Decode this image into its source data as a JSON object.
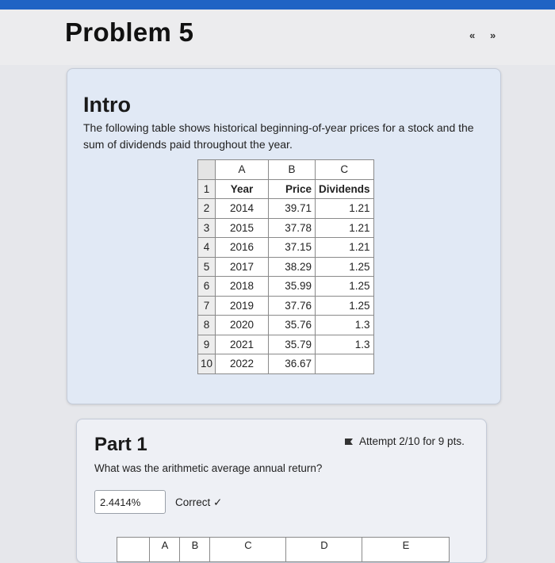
{
  "page": {
    "title": "Problem 5",
    "nav_prev": "«",
    "nav_next": "»"
  },
  "intro": {
    "title": "Intro",
    "text": "The following table shows historical beginning-of-year prices for a stock and the sum of dividends paid throughout the year."
  },
  "sheet": {
    "col_letters": [
      "A",
      "B",
      "C"
    ],
    "header": {
      "num": "1",
      "a": "Year",
      "b": "Price",
      "c": "Dividends"
    },
    "rows": [
      {
        "num": "2",
        "year": "2014",
        "price": "39.71",
        "div": "1.21"
      },
      {
        "num": "3",
        "year": "2015",
        "price": "37.78",
        "div": "1.21"
      },
      {
        "num": "4",
        "year": "2016",
        "price": "37.15",
        "div": "1.21"
      },
      {
        "num": "5",
        "year": "2017",
        "price": "38.29",
        "div": "1.25"
      },
      {
        "num": "6",
        "year": "2018",
        "price": "35.99",
        "div": "1.25"
      },
      {
        "num": "7",
        "year": "2019",
        "price": "37.76",
        "div": "1.25"
      },
      {
        "num": "8",
        "year": "2020",
        "price": "35.76",
        "div": "1.3"
      },
      {
        "num": "9",
        "year": "2021",
        "price": "35.79",
        "div": "1.3"
      },
      {
        "num": "10",
        "year": "2022",
        "price": "36.67",
        "div": ""
      }
    ]
  },
  "part1": {
    "title": "Part 1",
    "attempt": "Attempt 2/10 for 9 pts.",
    "question": "What was the arithmetic average annual return?",
    "answer": "2.4414%",
    "status": "Correct ✓",
    "grid_letters": [
      "A",
      "B",
      "C",
      "D",
      "E"
    ]
  }
}
